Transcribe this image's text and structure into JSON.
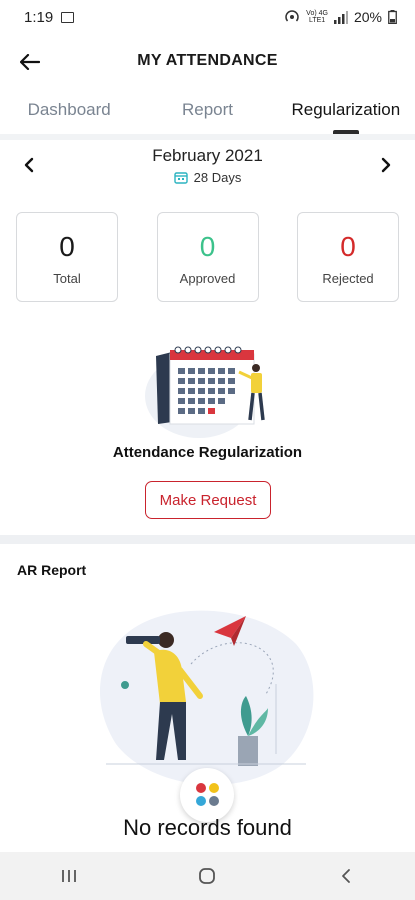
{
  "status_bar": {
    "time": "1:19",
    "network_type_top": "Vo) 4G",
    "network_type_bottom": "LTE1",
    "battery": "20%"
  },
  "header": {
    "title": "MY ATTENDANCE",
    "back_icon": "arrow-left-icon"
  },
  "tabs": [
    {
      "label": "Dashboard",
      "active": false
    },
    {
      "label": "Report",
      "active": false
    },
    {
      "label": "Regularization",
      "active": true
    }
  ],
  "month_selector": {
    "month": "February 2021",
    "days": "28 Days"
  },
  "stats": [
    {
      "value": "0",
      "label": "Total",
      "color": "#1a1a1a"
    },
    {
      "value": "0",
      "label": "Approved",
      "color": "#3cc28b"
    },
    {
      "value": "0",
      "label": "Rejected",
      "color": "#d42a2a"
    }
  ],
  "regularization": {
    "title": "Attendance Regularization",
    "button_label": "Make Request"
  },
  "ar_report": {
    "title": "AR Report",
    "empty_text": "No records found"
  },
  "colors": {
    "accent_red": "#c9232d",
    "approved_green": "#3cc28b",
    "teal": "#2bb3c0"
  }
}
